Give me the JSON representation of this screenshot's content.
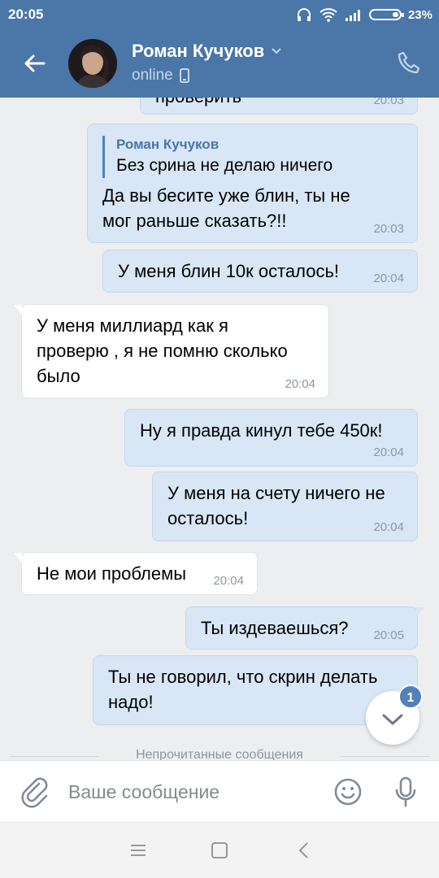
{
  "status_bar": {
    "time": "20:05",
    "battery": "23%",
    "battery_level": 0.23,
    "icons": [
      "headphones-icon",
      "wifi-icon",
      "signal-icon",
      "battery-icon"
    ]
  },
  "header": {
    "name": "Роман Кучуков",
    "status": "online",
    "icons": [
      "back-arrow-icon",
      "avatar",
      "chevron-down-icon",
      "mobile-icon",
      "phone-icon"
    ]
  },
  "messages": [
    {
      "dir": "out",
      "text": "проверить",
      "time": "20:03"
    },
    {
      "dir": "out",
      "quote_author": "Роман Кучуков",
      "quote_text": "Без срина не делаю ничего",
      "text": "Да вы бесите уже блин, ты не\nмог раньше сказать?!!",
      "time": "20:03"
    },
    {
      "dir": "out",
      "text": "У меня блин 10к осталось!",
      "time": "20:04"
    },
    {
      "dir": "in",
      "text": "У меня миллиард как я\nпроверю , я не помню сколько\nбыло",
      "time": "20:04"
    },
    {
      "dir": "out",
      "text": "Ну я правда кинул тебе 450к!",
      "time": "20:04"
    },
    {
      "dir": "out",
      "text": "У меня на счету ничего не\nосталось!",
      "time": "20:04"
    },
    {
      "dir": "in",
      "text": "Не мои проблемы",
      "time": "20:04"
    },
    {
      "dir": "out",
      "text": "Ты издеваешься?",
      "time": "20:05"
    },
    {
      "dir": "out",
      "text": "Ты не говорил, что скрин делать\nнадо!",
      "time": ""
    }
  ],
  "unread_separator": "Непрочитанные сообщения",
  "scroll_fab": {
    "badge": "1"
  },
  "composer": {
    "placeholder": "Ваше сообщение"
  },
  "colors": {
    "accent": "#4a76a8",
    "out_bubble": "#d8e6f6",
    "in_bubble": "#ffffff",
    "background": "#edeef0"
  }
}
